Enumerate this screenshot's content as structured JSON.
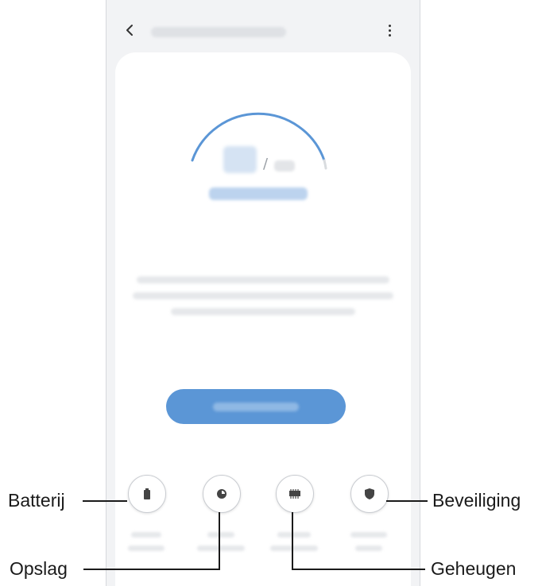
{
  "callouts": {
    "battery": "Batterij",
    "storage": "Opslag",
    "memory": "Geheugen",
    "security": "Beveiliging"
  },
  "gauge": {
    "slash": "/"
  },
  "colors": {
    "accent": "#5b96d6",
    "gauge_track": "#d9dcdf",
    "background": "#f2f3f5",
    "card": "#ffffff"
  },
  "icons": {
    "back": "chevron-left-icon",
    "menu": "more-vertical-icon",
    "battery": "battery-icon",
    "storage": "storage-icon",
    "memory": "memory-chip-icon",
    "security": "shield-icon"
  }
}
